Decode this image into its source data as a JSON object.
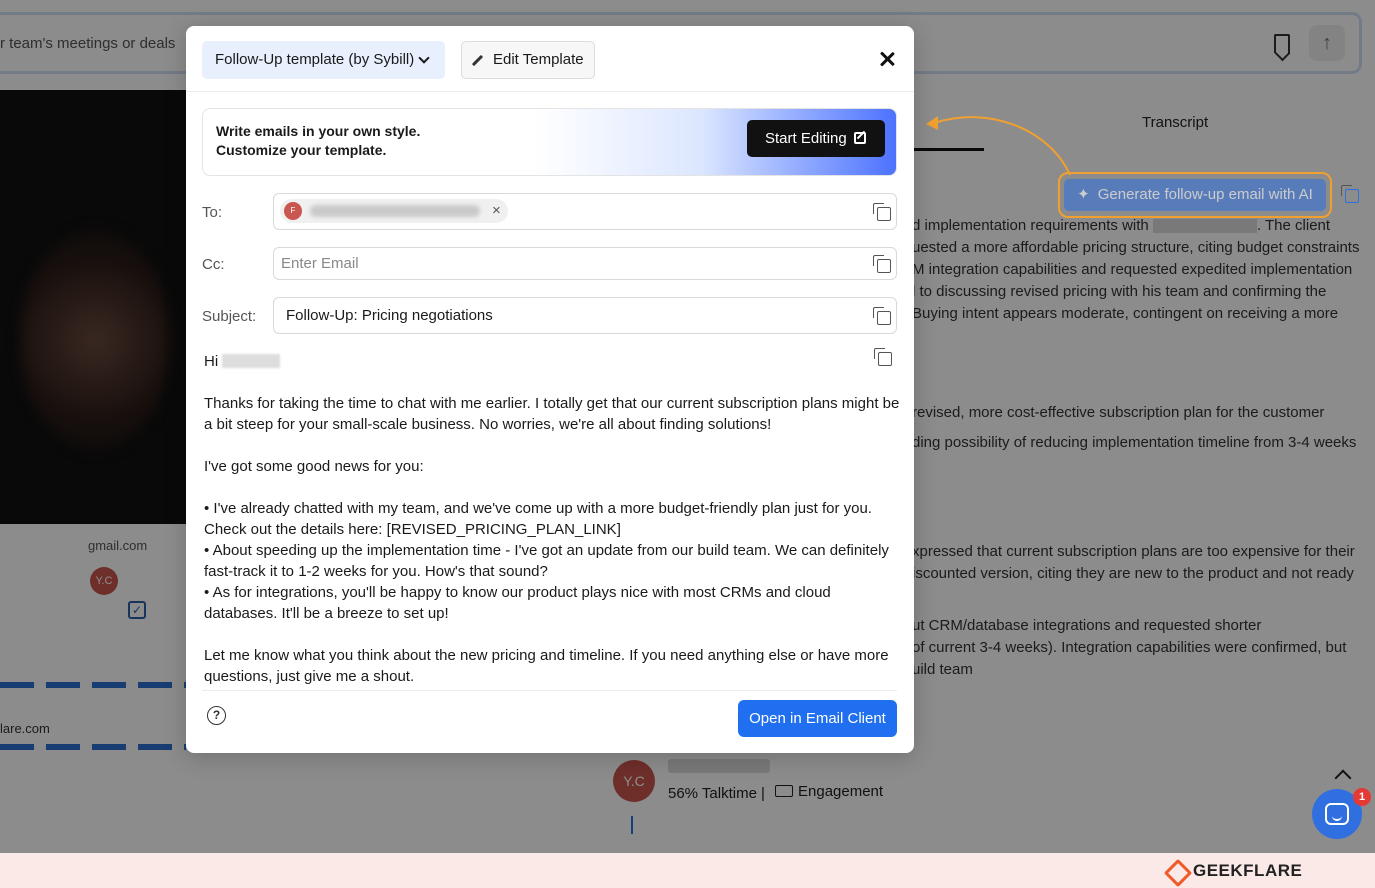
{
  "background": {
    "search_text": "r team's meetings or deals",
    "tab_transcript": "Transcript",
    "generate_button": "Generate follow-up email with AI",
    "sparkle_glyph": "✦",
    "gmail_text": "gmail.com",
    "avatar_initials": "Y.C",
    "lare_text": "lare.com",
    "summary_lines": [
      {
        "pre": "d implementation requirements with",
        "post": ". The client"
      },
      {
        "pre": "uested a more affordable pricing structure, citing budget constraints",
        "post": ""
      },
      {
        "pre": "M integration capabilities and requested expedited implementation",
        "post": ""
      },
      {
        "pre": "l to discussing revised pricing with his team and confirming the",
        "post": ""
      },
      {
        "pre": "Buying intent appears moderate, contingent on receiving a more",
        "post": ""
      },
      {
        "pre": " revised, more cost-effective subscription plan for the customer",
        "post": ""
      },
      {
        "pre": "ding possibility of reducing implementation timeline from 3-4 weeks",
        "post": ""
      },
      {
        "pre": "xpressed that current subscription plans are too expensive for their",
        "post": ""
      },
      {
        "pre": "iscounted version, citing they are new to the product and not ready",
        "post": ""
      },
      {
        "pre": "ut CRM/database integrations and requested shorter",
        "post": ""
      },
      {
        "pre": " of current 3-4 weeks). Integration capabilities were confirmed, but",
        "post": ""
      },
      {
        "pre": "uild team",
        "post": ""
      }
    ],
    "talktime": "56% Talktime",
    "engagement": "Engagement",
    "separator": "|",
    "chat_badge": "1"
  },
  "modal": {
    "template_select": "Follow-Up template (by Sybill)",
    "edit_template": "Edit Template",
    "banner_line1": "Write emails in your own style.",
    "banner_line2": "Customize your template.",
    "start_editing": "Start Editing",
    "to_label": "To:",
    "cc_label": "Cc:",
    "cc_placeholder": "Enter Email",
    "subject_label": "Subject:",
    "subject_value": "Follow-Up: Pricing negotiations",
    "recipient_initial": "F",
    "chip_remove": "×",
    "greeting": "Hi",
    "body_paragraphs": [
      "Thanks for taking the time to chat with me earlier. I totally get that our current subscription plans might be a bit steep for your small-scale business. No worries, we're all about finding solutions!",
      "I've got some good news for you:",
      "• I've already chatted with my team, and we've come up with a more budget-friendly plan just for you. Check out the details here: [REVISED_PRICING_PLAN_LINK]\n• About speeding up the implementation time - I've got an update from our build team. We can definitely fast-track it to 1-2 weeks for you. How's that sound?\n• As for integrations, you'll be happy to know our product plays nice with most CRMs and cloud databases. It'll be a breeze to set up!",
      "Let me know what you think about the new pricing and timeline. If you need anything else or have more questions, just give me a shout."
    ],
    "help_glyph": "?",
    "open_email_client": "Open in Email Client"
  },
  "footer": {
    "brand": "GEEKFLARE"
  }
}
